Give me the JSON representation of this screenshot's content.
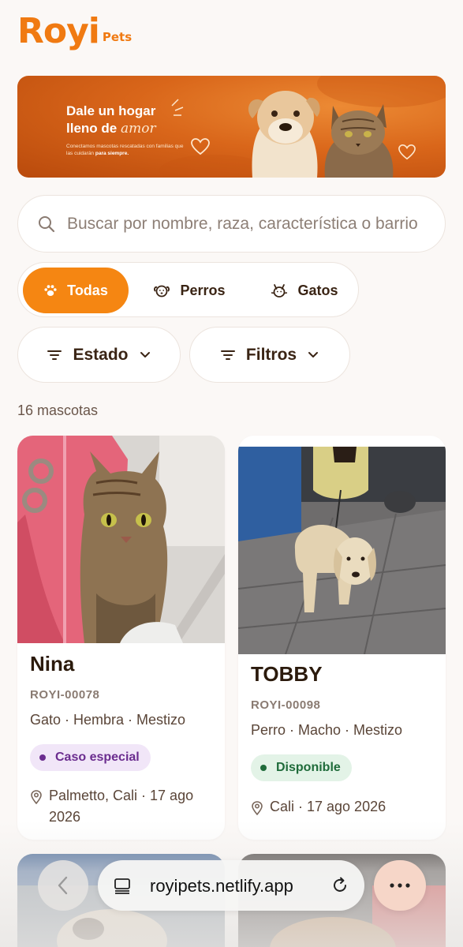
{
  "brand": {
    "name": "Royi",
    "sub": "Pets",
    "accent": "#f58612"
  },
  "banner": {
    "title_line1": "Dale un hogar",
    "title_line2_prefix": "lleno de ",
    "title_line2_highlight": "amor",
    "subtitle_part1": "Conectamos mascotas rescatadas con familias que las cuidarán ",
    "subtitle_bold": "para siempre."
  },
  "search": {
    "placeholder": "Buscar por nombre, raza, característica o barrio"
  },
  "species_tabs": [
    {
      "label": "Todas",
      "icon": "paw-icon",
      "active": true
    },
    {
      "label": "Perros",
      "icon": "dog-icon",
      "active": false
    },
    {
      "label": "Gatos",
      "icon": "cat-icon",
      "active": false
    }
  ],
  "filters": [
    {
      "label": "Estado",
      "icon": "filter-lines-icon"
    },
    {
      "label": "Filtros",
      "icon": "filter-lines-icon"
    }
  ],
  "count_label": "16 mascotas",
  "pets": [
    {
      "name": "Nina",
      "code": "ROYI-00078",
      "desc": "Gato · Hembra · Mestizo",
      "status": "Caso especial",
      "status_bg": "#f1e6f8",
      "status_color": "#6b2d8f",
      "location_line1": "Palmetto, Cali · 17 ago",
      "location_line2": "2026"
    },
    {
      "name": "TOBBY",
      "code": "ROYI-00098",
      "desc": "Perro · Macho · Mestizo",
      "status": "Disponible",
      "status_bg": "#e3f3e7",
      "status_color": "#1f6b3a",
      "location_line1": "Cali · 17 ago 2026",
      "location_line2": ""
    }
  ],
  "browser": {
    "url": "royipets.netlify.app"
  }
}
